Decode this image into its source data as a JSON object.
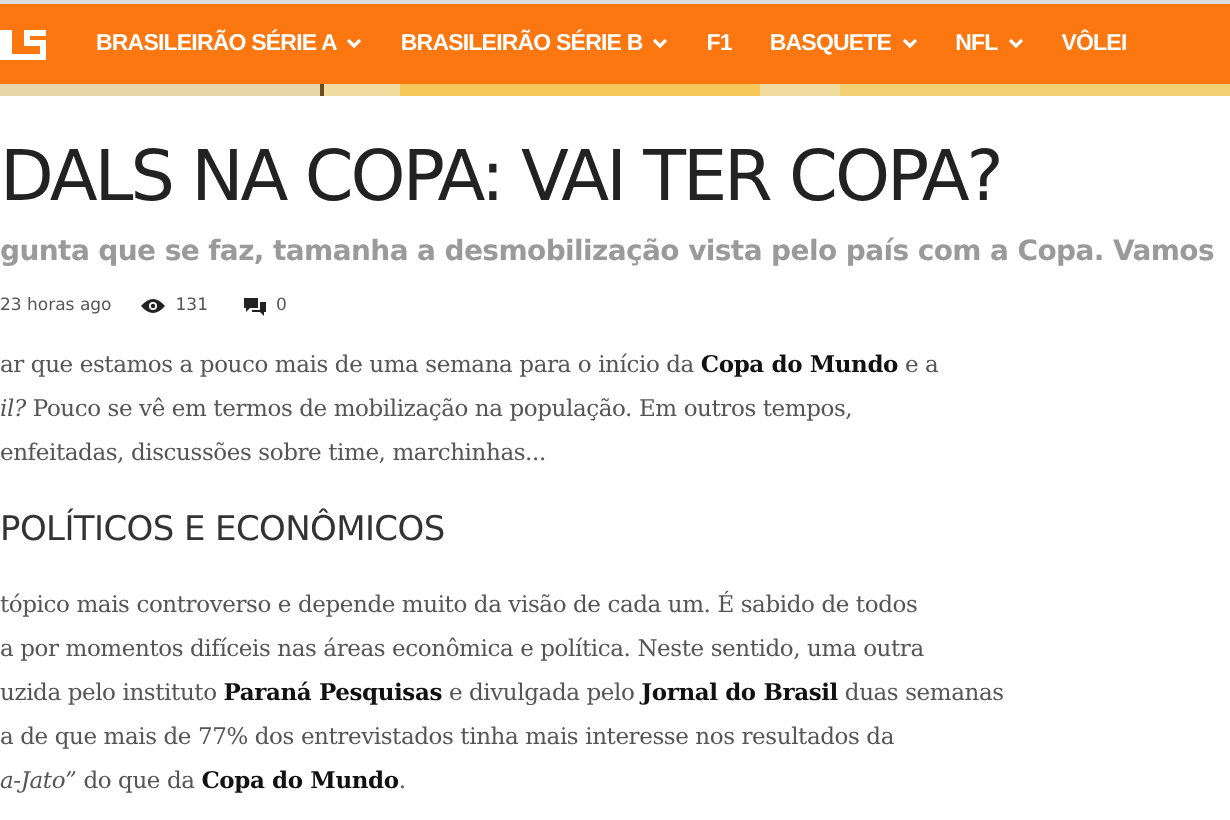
{
  "nav": {
    "items": [
      {
        "label": "BRASILEIRÃO SÉRIE A",
        "dropdown": true
      },
      {
        "label": "BRASILEIRÃO SÉRIE B",
        "dropdown": true
      },
      {
        "label": "F1",
        "dropdown": false
      },
      {
        "label": "BASQUETE",
        "dropdown": true
      },
      {
        "label": "NFL",
        "dropdown": true
      },
      {
        "label": "VÔLEI",
        "dropdown": false
      }
    ]
  },
  "article": {
    "title": "DALS NA COPA: VAI TER COPA?",
    "subtitle": "gunta que se faz, tamanha a desmobilização vista pelo país com a Copa. Vamos",
    "meta": {
      "time": "23 horas ago",
      "views": "131",
      "comments": "0"
    },
    "paragraph_1": [
      "ar que estamos a pouco mais de uma semana para o início da **Copa do Mundo** e a",
      "*il?* Pouco se vê em termos de mobilização na população. Em outros tempos,",
      "enfeitadas, discussões sobre time, marchinhas..."
    ],
    "heading": "POLÍTICOS E ECONÔMICOS",
    "paragraph_2": [
      "tópico mais controverso e depende muito da visão de cada um. É sabido de todos",
      "a por momentos difíceis nas áreas econômica e política. Neste sentido, uma outra",
      "uzida pelo instituto **Paraná Pesquisas** e divulgada pelo **Jornal do Brasil** duas semanas",
      "a de que mais de 77% dos entrevistados tinha mais interesse nos resultados da",
      "*a-Jato”* do que da **Copa do Mundo**."
    ]
  }
}
